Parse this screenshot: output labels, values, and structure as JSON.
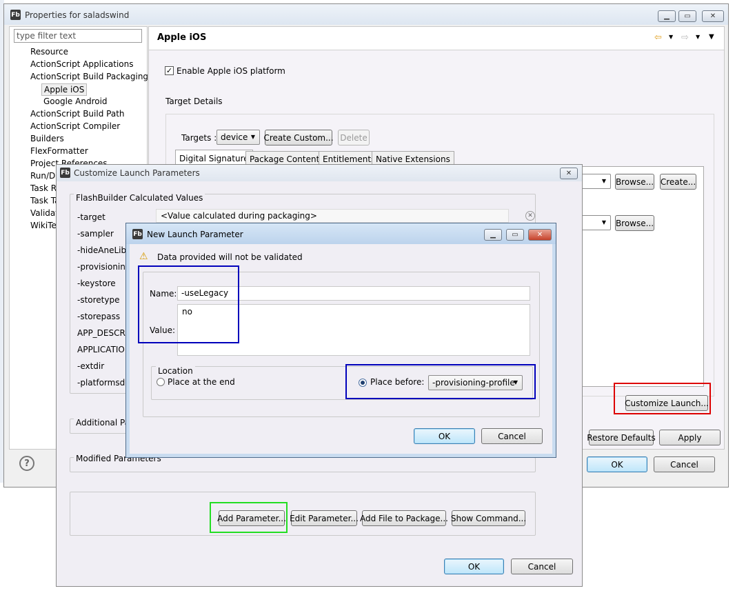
{
  "colors": {
    "highlight_red": "#dd0000",
    "highlight_green": "#22dd22",
    "highlight_blue": "#0000bb",
    "dialog_bg": "#f0eef4",
    "title_active": "#c4d8ef",
    "title_inactive": "#e4ebf3"
  },
  "properties": {
    "title": "Properties for saladswind",
    "filter_placeholder": "type filter text",
    "tree": [
      "Resource",
      "ActionScript Applications",
      "ActionScript Build Packaging",
      "Apple iOS",
      "Google Android",
      "ActionScript Build Path",
      "ActionScript Compiler",
      "Builders",
      "FlexFormatter",
      "Project References",
      "Run/De",
      "Task Re",
      "Task Ta",
      "Validati",
      "WikiTex"
    ],
    "page_title": "Apple iOS",
    "enable_label": "Enable Apple iOS platform",
    "target_details": "Target Details",
    "targets_label": "Targets :",
    "targets_value": "device",
    "create_custom": "Create Custom...",
    "delete": "Delete",
    "tabs": [
      "Digital Signature",
      "Package Contents",
      "Entitlements",
      "Native Extensions"
    ],
    "browse": "Browse...",
    "create": "Create...",
    "customize_launch": "Customize Launch...",
    "restore_defaults": "Restore Defaults",
    "apply": "Apply",
    "ok": "OK",
    "cancel": "Cancel",
    "help_icon": "?"
  },
  "customize": {
    "title": "Customize Launch Parameters",
    "calc_group": "FlashBuilder Calculated Values",
    "params": [
      "-target",
      "-sampler",
      "-hideAneLibS",
      "-provisioning",
      "-keystore",
      "-storetype",
      "-storepass",
      "APP_DESCRIP",
      "APPLICATION",
      "-extdir",
      "-platformsdk"
    ],
    "target_value": "<Value calculated during packaging>",
    "additional_group": "Additional Pa",
    "modified_group": "Modified Parameters",
    "add_parameter": "Add Parameter...",
    "edit_parameter": "Edit Parameter...",
    "add_file": "Add File to Package...",
    "show_command": "Show Command...",
    "ok": "OK",
    "cancel": "Cancel"
  },
  "new_param": {
    "title": "New Launch Parameter",
    "warning": "Data provided will not be validated",
    "name_label": "Name:",
    "name_value": "-useLegacy",
    "value_label": "Value:",
    "value_value": "no",
    "location_group": "Location",
    "place_end": "Place at the end",
    "place_before": "Place before:",
    "place_before_value": "-provisioning-profile",
    "ok": "OK",
    "cancel": "Cancel"
  }
}
